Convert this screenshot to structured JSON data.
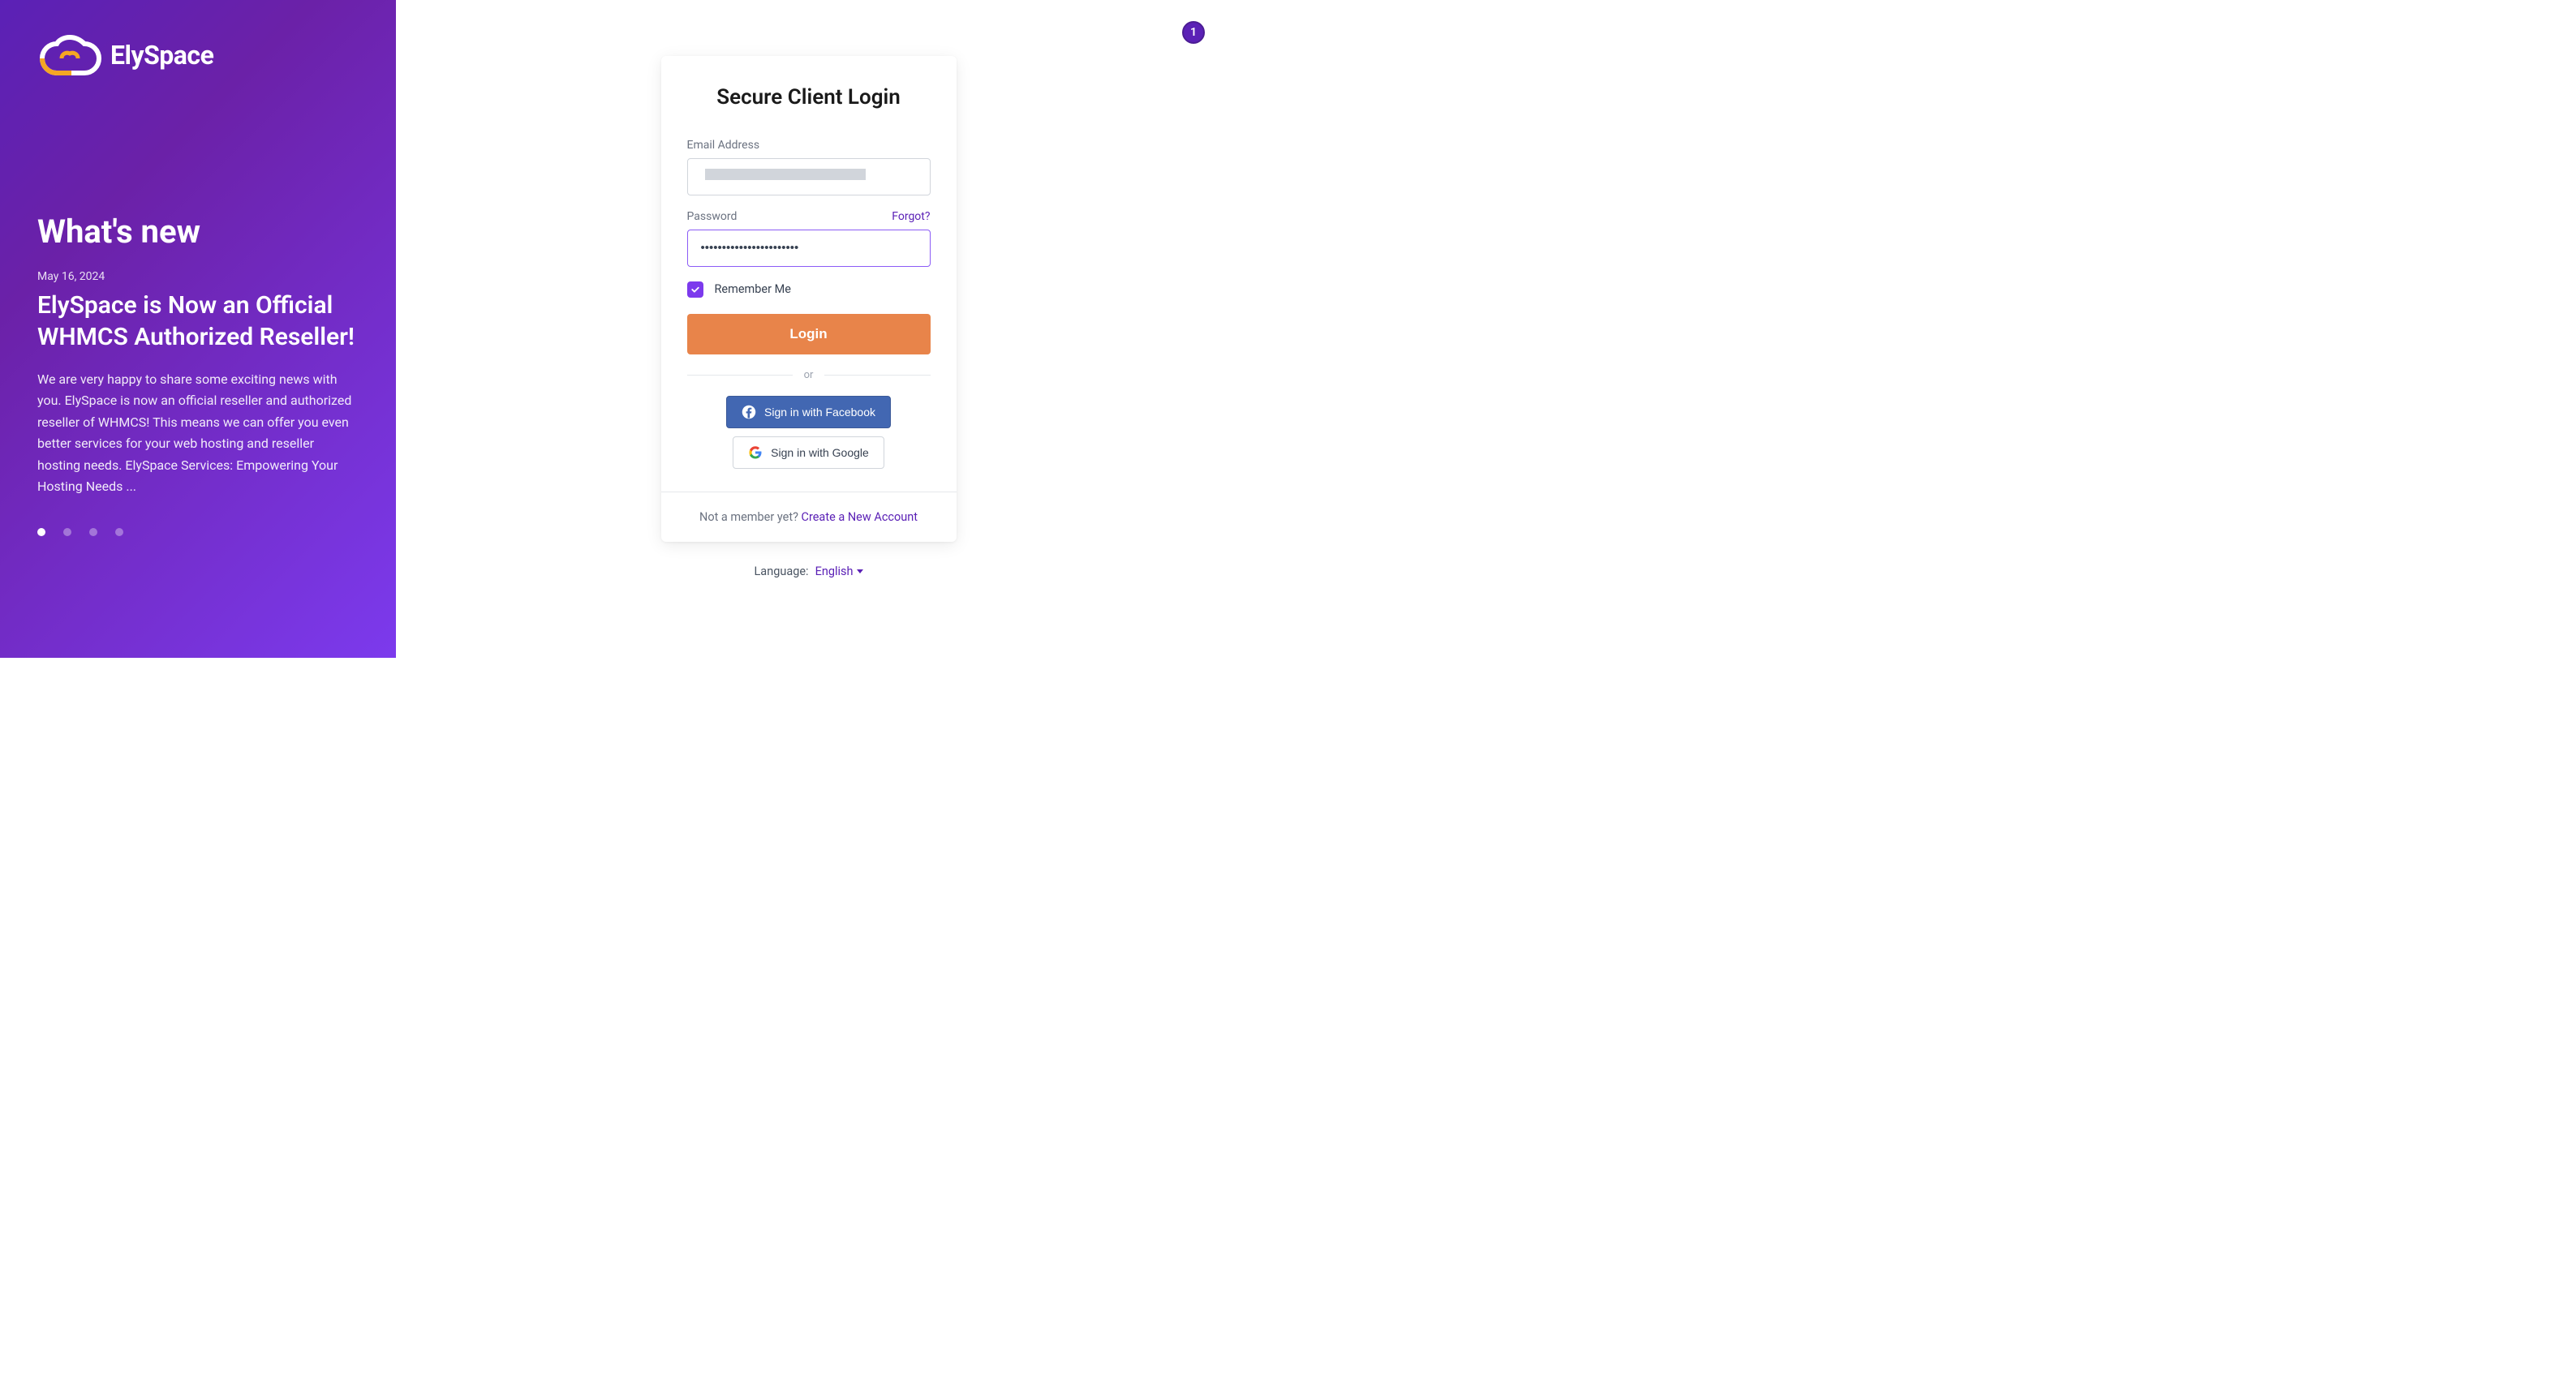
{
  "brand": {
    "name": "ElySpace"
  },
  "news": {
    "section_title": "What's new",
    "date": "May 16, 2024",
    "headline": "ElySpace is Now an Official WHMCS Authorized Reseller!",
    "body": "We are very happy to share some exciting news with you. ElySpace is now an official reseller and authorized reseller of WHMCS! This means we can offer you even better services for your web hosting and reseller hosting needs. ElySpace Services: Empowering Your Hosting Needs ..."
  },
  "notification": {
    "count": "1"
  },
  "login": {
    "title": "Secure Client Login",
    "email_label": "Email Address",
    "password_label": "Password",
    "password_value": "•••••••••••••••••••••••",
    "forgot_link": "Forgot?",
    "remember_label": "Remember Me",
    "login_button": "Login",
    "divider": "or",
    "facebook_button": "Sign in with Facebook",
    "google_button": "Sign in with Google",
    "footer_text": "Not a member yet? ",
    "create_account": "Create a New Account"
  },
  "language": {
    "label": "Language:",
    "selected": "English"
  }
}
